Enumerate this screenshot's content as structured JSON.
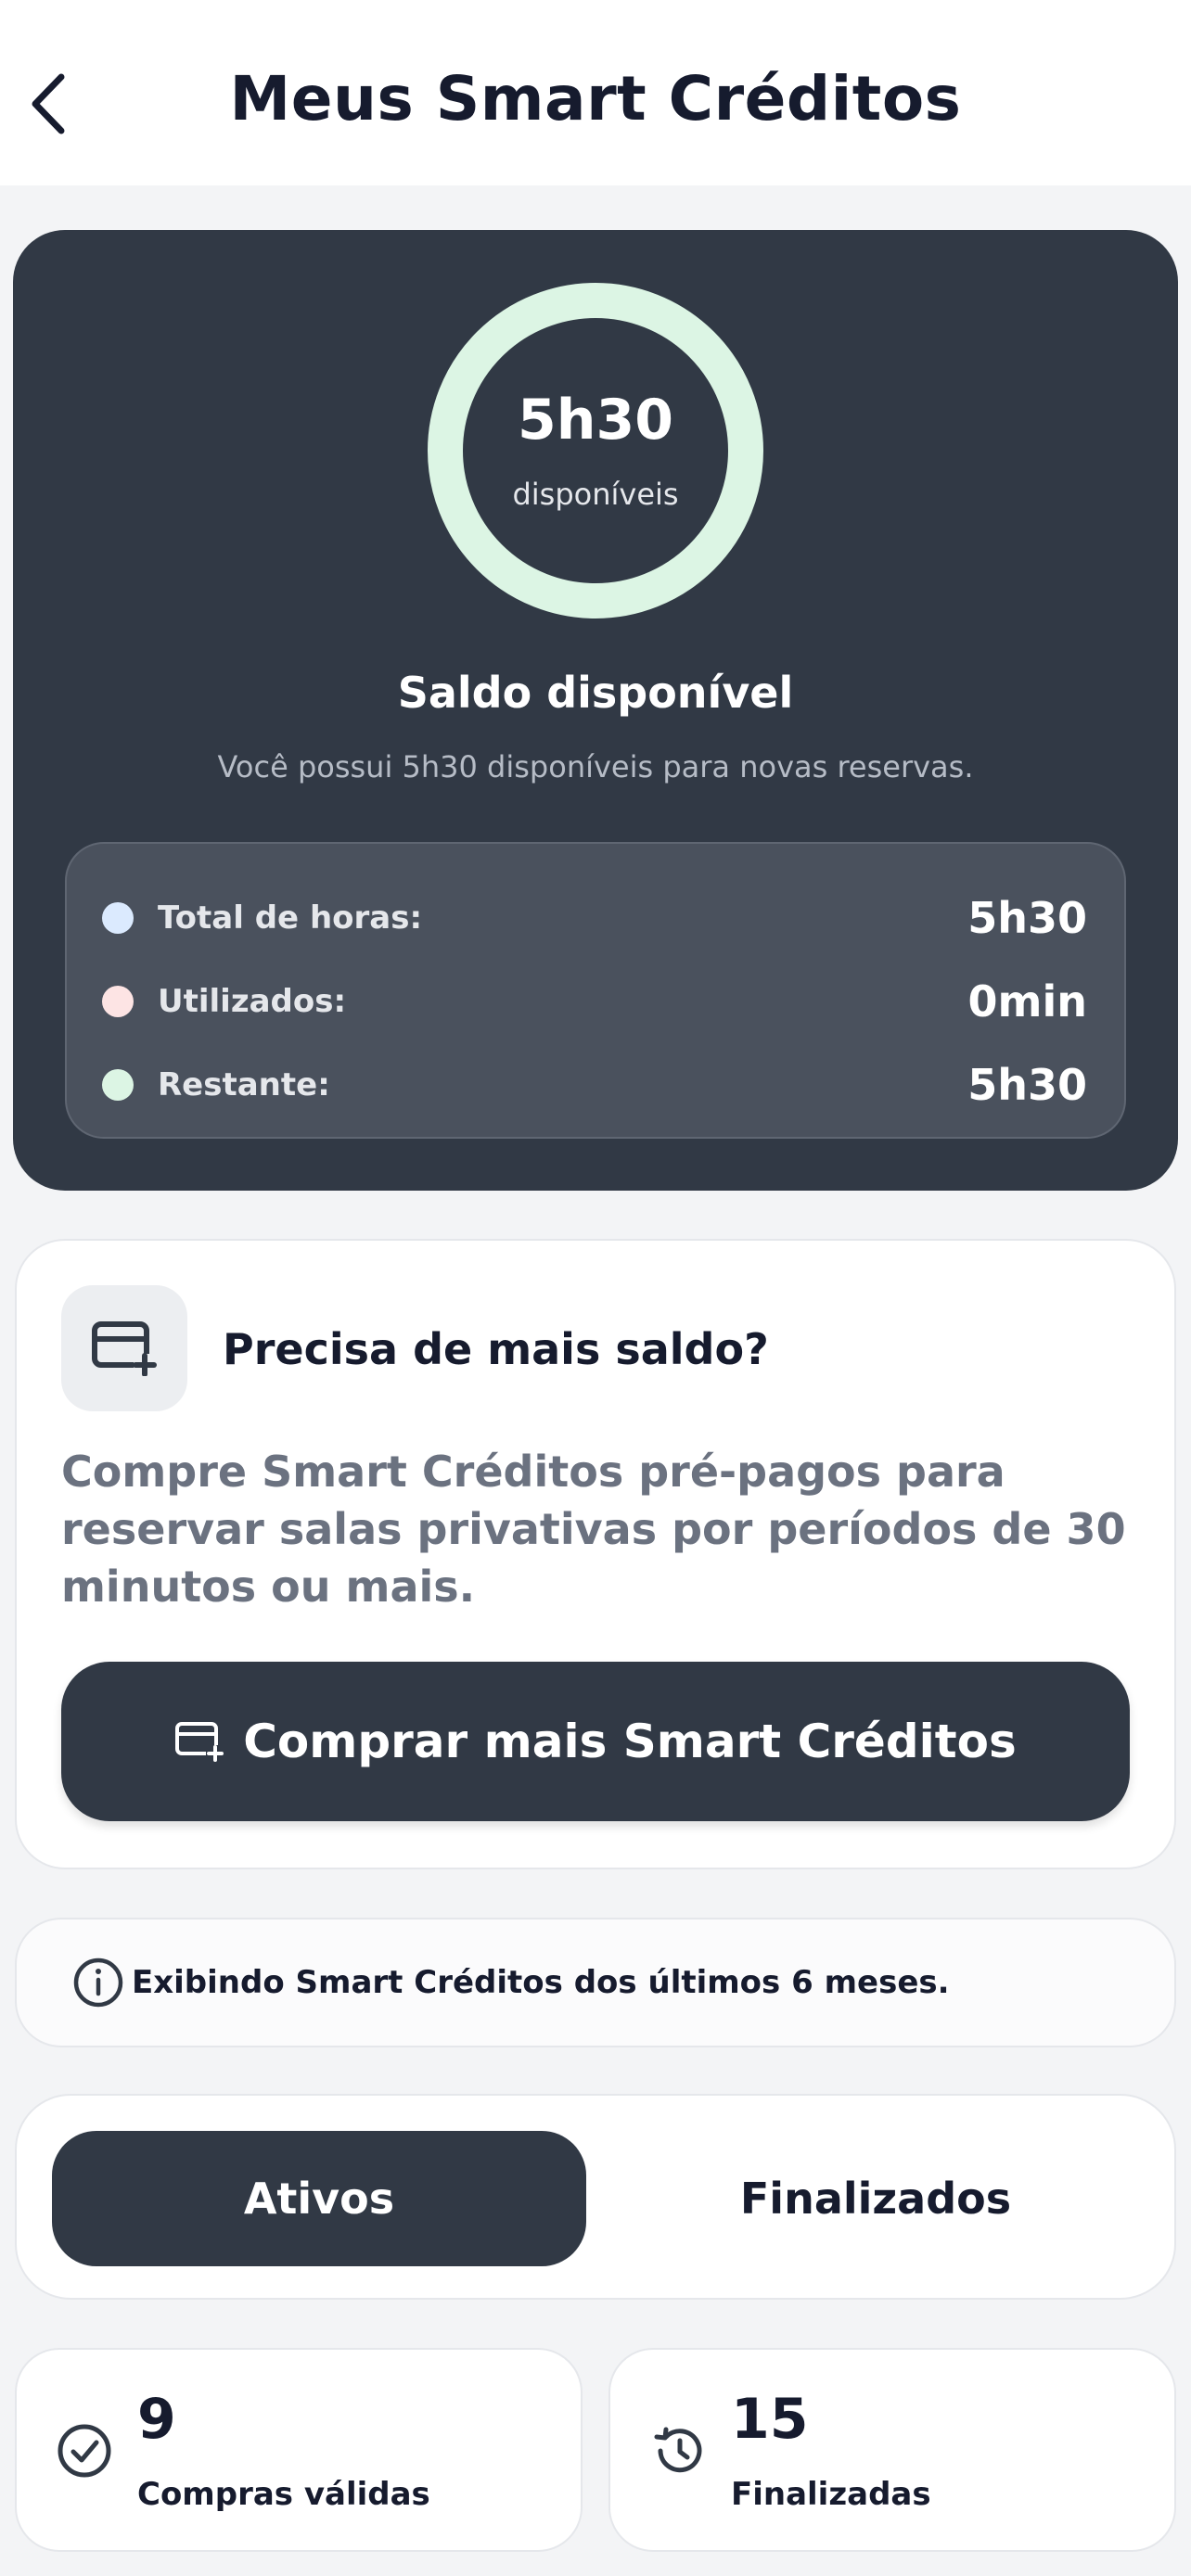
{
  "header": {
    "title": "Meus Smart Créditos"
  },
  "balance": {
    "ring_value": "5h30",
    "ring_sub": "disponíveis",
    "title": "Saldo disponível",
    "description": "Você possui 5h30 disponíveis para novas reservas.",
    "ring_color": "#dcf5e4",
    "stats": [
      {
        "label": "Total de horas:",
        "value": "5h30",
        "dot_color": "#dbeafe"
      },
      {
        "label": "Utilizados:",
        "value": "0min",
        "dot_color": "#fde4e4"
      },
      {
        "label": "Restante:",
        "value": "5h30",
        "dot_color": "#dcf5e4"
      }
    ]
  },
  "more": {
    "title": "Precisa de mais saldo?",
    "description": "Compre Smart Créditos pré-pagos para reservar salas privativas por períodos de 30 minutos ou mais.",
    "button_label": "Comprar mais Smart Créditos"
  },
  "info": {
    "text": "Exibindo Smart Créditos dos últimos 6 meses."
  },
  "tabs": [
    {
      "label": "Ativos",
      "active": true
    },
    {
      "label": "Finalizados",
      "active": false
    }
  ],
  "summary": [
    {
      "value": "9",
      "label": "Compras válidas",
      "icon": "check-circle-icon"
    },
    {
      "value": "15",
      "label": "Finalizadas",
      "icon": "history-icon"
    }
  ],
  "colors": {
    "dark": "#313945",
    "title": "#161b2e",
    "background": "#f3f4f6"
  }
}
